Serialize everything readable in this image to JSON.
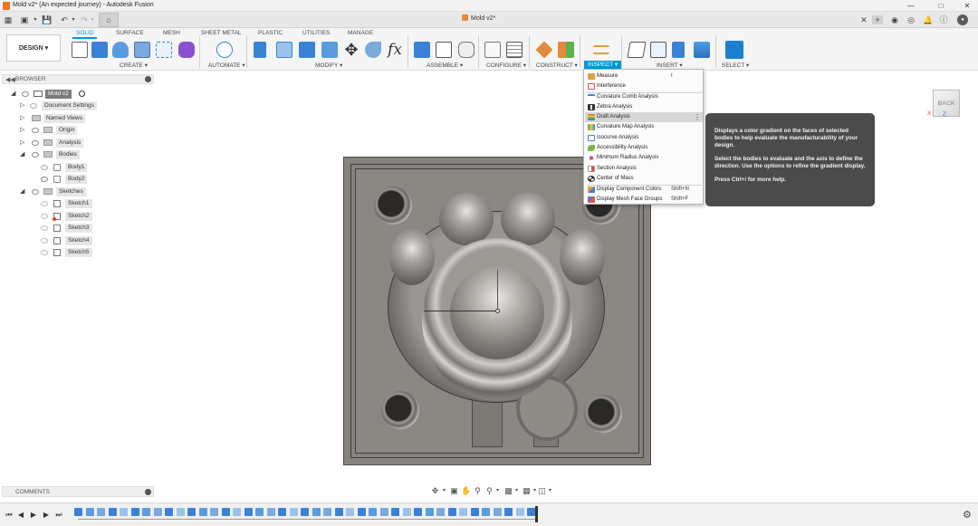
{
  "window": {
    "title": "Mold v2* (An expected journey) - Autodesk Fusion",
    "controls": [
      "minimize",
      "maximize",
      "close"
    ]
  },
  "document_tab": {
    "label": "Mold v2*"
  },
  "workspace_button": {
    "label": "DESIGN ▾"
  },
  "ribbon_tabs": [
    {
      "label": "SOLID",
      "active": true
    },
    {
      "label": "SURFACE",
      "active": false
    },
    {
      "label": "MESH",
      "active": false
    },
    {
      "label": "SHEET METAL",
      "active": false
    },
    {
      "label": "PLASTIC",
      "active": false
    },
    {
      "label": "UTILITIES",
      "active": false
    },
    {
      "label": "MANAGE",
      "active": false
    }
  ],
  "ribbon_groups": [
    {
      "label": "CREATE ▾"
    },
    {
      "label": "AUTOMATE ▾"
    },
    {
      "label": "MODIFY ▾"
    },
    {
      "label": "ASSEMBLE ▾"
    },
    {
      "label": "CONFIGURE ▾"
    },
    {
      "label": "CONSTRUCT ▾"
    },
    {
      "label": "INSPECT ▾",
      "active": true
    },
    {
      "label": "INSERT ▾"
    },
    {
      "label": "SELECT ▾"
    }
  ],
  "browser": {
    "title": "BROWSER",
    "root": {
      "label": "Mold v2"
    },
    "items": [
      {
        "label": "Document Settings"
      },
      {
        "label": "Named Views"
      },
      {
        "label": "Origin"
      },
      {
        "label": "Analysis"
      },
      {
        "label": "Bodies"
      },
      {
        "label": "Body1"
      },
      {
        "label": "Body2"
      },
      {
        "label": "Sketches"
      },
      {
        "label": "Sketch1"
      },
      {
        "label": "Sketch2"
      },
      {
        "label": "Sketch3"
      },
      {
        "label": "Sketch4"
      },
      {
        "label": "Sketch5"
      }
    ]
  },
  "inspect_menu": {
    "items": [
      {
        "label": "Measure",
        "shortcut": "I",
        "icon": "ruler-icon",
        "color": "#d9a441"
      },
      {
        "label": "Interference",
        "shortcut": "",
        "icon": "interference-icon",
        "color": "#d9534f"
      },
      {
        "label": "Curvature Comb Analysis",
        "shortcut": "",
        "icon": "curvature-comb-icon",
        "color": "#4f7fd0"
      },
      {
        "label": "Zebra Analysis",
        "shortcut": "",
        "icon": "zebra-icon",
        "color": "#444444"
      },
      {
        "label": "Draft Analysis",
        "shortcut": "",
        "icon": "draft-analysis-icon",
        "color": "#e05a3a",
        "highlighted": true
      },
      {
        "label": "Curvature Map Analysis",
        "shortcut": "",
        "icon": "curvature-map-icon",
        "color": "#3fb24f"
      },
      {
        "label": "Isocurve Analysis",
        "shortcut": "",
        "icon": "isocurve-icon",
        "color": "#4f7fd0"
      },
      {
        "label": "Accessibility Analysis",
        "shortcut": "",
        "icon": "accessibility-icon",
        "color": "#7ab648"
      },
      {
        "label": "Minimum Radius Analysis",
        "shortcut": "",
        "icon": "minimum-radius-icon",
        "color": "#c94f9a"
      },
      {
        "label": "Section Analysis",
        "shortcut": "",
        "icon": "section-analysis-icon",
        "color": "#d9534f"
      },
      {
        "label": "Center of Mass",
        "shortcut": "",
        "icon": "center-of-mass-icon",
        "color": "#555555"
      },
      {
        "label": "Display Component Colors",
        "shortcut": "Shift+N",
        "icon": "component-colors-icon",
        "color": "#e0a43a"
      },
      {
        "label": "Display Mesh Face Groups",
        "shortcut": "Shift+F",
        "icon": "mesh-face-groups-icon",
        "color": "#7a6bc9"
      }
    ]
  },
  "tooltip": {
    "para1": "Displays a color gradient on the faces of selected bodies to help evaluate the manufacturability of your design.",
    "para2": "Select the bodies to evaluate and the axis to define the direction. Use the options to refine the gradient display.",
    "para3": "Press Ctrl+/ for more help."
  },
  "viewcube": {
    "face_label": "BACK",
    "x_axis": "X",
    "z_axis": "Z"
  },
  "comments": {
    "title": "COMMENTS"
  },
  "colors": {
    "accent": "#0696d7",
    "model_gray": "#86837f",
    "tooltip_bg": "#4b4b4b"
  }
}
